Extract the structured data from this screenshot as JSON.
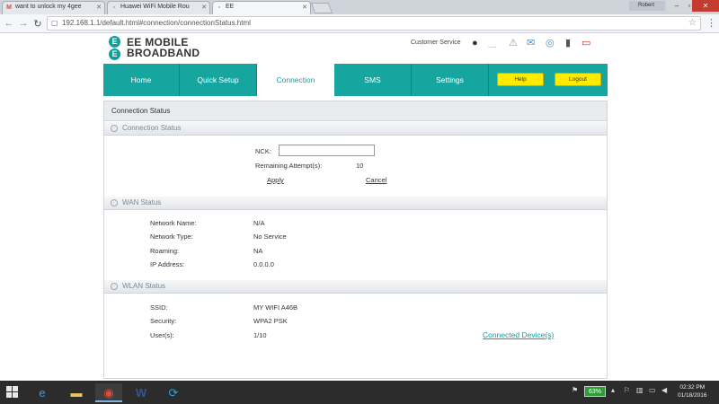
{
  "browser": {
    "tabs": [
      {
        "label": "want to unlock my 4gee",
        "icon": "gmail-icon"
      },
      {
        "label": "Huawei WiFi Mobile Rou",
        "icon": "page-icon"
      },
      {
        "label": "EE",
        "icon": "page-icon"
      }
    ],
    "user": "Robert",
    "url": "192.168.1.1/default.html#connection/connectionStatus.html"
  },
  "header": {
    "logo_line1": "EE MOBILE",
    "logo_line2": "BROADBAND",
    "logo_mark": "E",
    "customer_service": "Customer Service",
    "signal_label": "....."
  },
  "nav": {
    "home": "Home",
    "quick_setup": "Quick Setup",
    "connection": "Connection",
    "sms": "SMS",
    "settings": "Settings",
    "help": "Help",
    "logout": "Logout"
  },
  "breadcrumb": "Connection Status",
  "connection_status": {
    "title": "Connection Status",
    "nck_label": "NCK:",
    "nck_value": "",
    "remaining_label": "Remaining Attempt(s):",
    "remaining_value": "10",
    "apply": "Apply",
    "cancel": "Cancel"
  },
  "wan_status": {
    "title": "WAN Status",
    "rows": [
      {
        "label": "Network Name:",
        "value": "N/A"
      },
      {
        "label": "Network Type:",
        "value": "No Service"
      },
      {
        "label": "Roaming:",
        "value": "NA"
      },
      {
        "label": "IP Address:",
        "value": "0.0.0.0"
      }
    ]
  },
  "wlan_status": {
    "title": "WLAN Status",
    "rows": [
      {
        "label": "SSID:",
        "value": "MY WIFI A46B"
      },
      {
        "label": "Security:",
        "value": "WPA2 PSK"
      },
      {
        "label": "User(s):",
        "value": "1/10"
      }
    ],
    "connected_devices": "Connected Device(s)"
  },
  "taskbar": {
    "battery": "63%",
    "time": "02:32 PM",
    "date": "01/18/2016"
  },
  "colors": {
    "ee_teal": "#16a69f",
    "ee_yellow": "#ffeb00"
  }
}
